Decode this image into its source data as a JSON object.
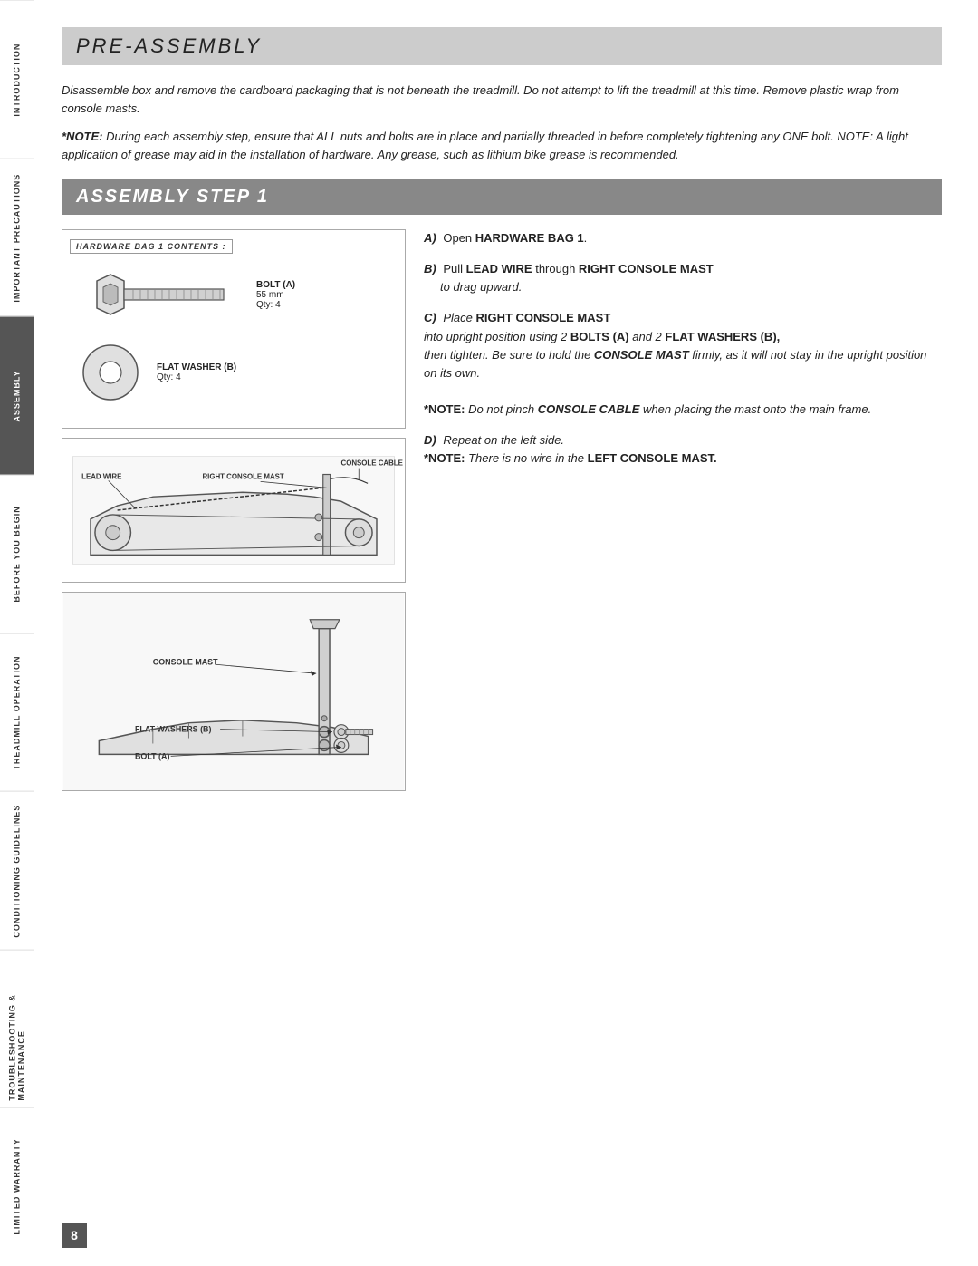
{
  "sidebar": {
    "tabs": [
      {
        "id": "introduction",
        "label": "INTRODUCTION",
        "active": false
      },
      {
        "id": "important-precautions",
        "label": "IMPORTANT PRECAUTIONS",
        "active": false
      },
      {
        "id": "assembly",
        "label": "ASSEMBLY",
        "active": true
      },
      {
        "id": "before-you-begin",
        "label": "BEFORE YOU BEGIN",
        "active": false
      },
      {
        "id": "treadmill-operation",
        "label": "TREADMILL OPERATION",
        "active": false
      },
      {
        "id": "conditioning-guidelines",
        "label": "CONDITIONING GUIDELINES",
        "active": false
      },
      {
        "id": "troubleshooting-maintenance",
        "label": "TROUBLESHOOTING & MAINTENANCE",
        "active": false
      },
      {
        "id": "limited-warranty",
        "label": "LIMITED WARRANTY",
        "active": false
      }
    ]
  },
  "page": {
    "number": "8",
    "section_title": "PRE-ASSEMBLY",
    "intro_paragraph": "Disassemble box and remove the cardboard packaging that is not beneath the treadmill. Do not attempt to lift the treadmill at this time. Remove plastic wrap from console masts.",
    "note_label": "*NOTE:",
    "note_text": " During each assembly step, ensure that ALL nuts and bolts are in place and partially threaded in before completely tightening any ONE bolt. NOTE: A light application of grease may aid in the installation of hardware. Any grease, such as lithium bike grease is recommended.",
    "step_title_italic": "ASSEMBLY ",
    "step_title_bold": "STEP 1",
    "hardware_bag_label": "HARDWARE BAG 1 CONTENTS :",
    "hardware": {
      "bolt": {
        "name": "BOLT (A)",
        "size": "55 mm",
        "qty_label": "Qty:",
        "qty": "4"
      },
      "washer": {
        "name": "FLAT WASHER (B)",
        "qty_label": "Qty:",
        "qty": "4"
      }
    },
    "diagram_labels": {
      "diagram2": {
        "lead_wire": "LEAD WIRE",
        "right_console_mast": "RIGHT CONSOLE MAST",
        "console_cable": "CONSOLE CABLE"
      },
      "diagram3": {
        "console_mast": "CONSOLE MAST",
        "flat_washers": "FLAT WASHERS (B)",
        "bolt_a": "BOLT (A)"
      }
    },
    "instructions": {
      "a": {
        "letter": "A)",
        "text_normal": "Open ",
        "text_bold": "HARDWARE BAG 1",
        "text_end": "."
      },
      "b": {
        "letter": "B)",
        "text_normal": "Pull ",
        "text_bold1": "LEAD WIRE",
        "text_middle": " through ",
        "text_bold2": "RIGHT CONSOLE MAST",
        "text_end": " to drag upward."
      },
      "c": {
        "letter": "C)",
        "text_intro": "Place ",
        "text_bold1": "RIGHT CONSOLE MAST",
        "text_normal1": " into upright position using 2 ",
        "text_bold2": "BOLTS (A)",
        "text_normal2": " and 2 ",
        "text_bold3": "FLAT WASHERS (B),",
        "text_normal3": " then tighten. Be sure to hold the ",
        "text_bold4": "CONSOLE MAST",
        "text_normal4": " firmly, as it will not stay in the upright position on its own.",
        "note_label": "*NOTE:",
        "note_text": " Do not pinch ",
        "note_bold": "CONSOLE CABLE",
        "note_end": " when placing the mast onto the main frame."
      },
      "d": {
        "letter": "D)",
        "text_normal": "Repeat on the left side.",
        "note_label": "*NOTE:",
        "note_text": " There is no wire in the ",
        "note_bold": "LEFT CONSOLE MAST."
      }
    }
  }
}
